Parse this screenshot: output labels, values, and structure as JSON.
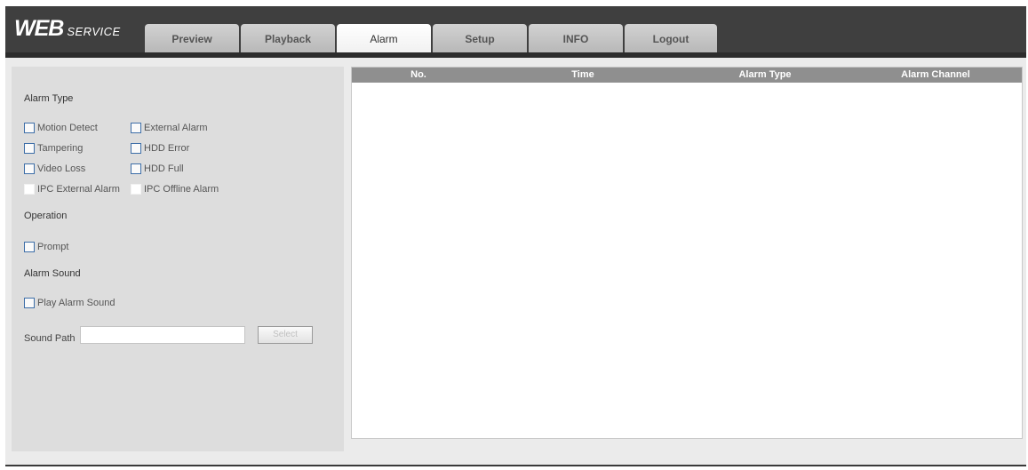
{
  "app": {
    "logo_main": "WEB",
    "logo_sub": "SERVICE"
  },
  "tabs": [
    {
      "label": "Preview",
      "active": false
    },
    {
      "label": "Playback",
      "active": false
    },
    {
      "label": "Alarm",
      "active": true
    },
    {
      "label": "Setup",
      "active": false
    },
    {
      "label": "INFO",
      "active": false
    },
    {
      "label": "Logout",
      "active": false
    }
  ],
  "alarm_type": {
    "title": "Alarm Type",
    "options": [
      {
        "label": "Motion Detect",
        "checked": false,
        "enabled": true
      },
      {
        "label": "External Alarm",
        "checked": false,
        "enabled": true
      },
      {
        "label": "Tampering",
        "checked": false,
        "enabled": true
      },
      {
        "label": "HDD Error",
        "checked": false,
        "enabled": true
      },
      {
        "label": "Video Loss",
        "checked": false,
        "enabled": true
      },
      {
        "label": "HDD Full",
        "checked": false,
        "enabled": true
      },
      {
        "label": "IPC External Alarm",
        "checked": false,
        "enabled": false
      },
      {
        "label": "IPC Offline Alarm",
        "checked": false,
        "enabled": false
      }
    ]
  },
  "operation": {
    "title": "Operation",
    "prompt_label": "Prompt",
    "prompt_checked": false
  },
  "alarm_sound": {
    "title": "Alarm Sound",
    "play_label": "Play Alarm Sound",
    "play_checked": false,
    "sound_path_label": "Sound Path",
    "sound_path_value": "",
    "select_label": "Select"
  },
  "alarm_table": {
    "columns": [
      "No.",
      "Time",
      "Alarm Type",
      "Alarm Channel"
    ],
    "rows": []
  },
  "colors": {
    "topbar": "#3f3f3f",
    "table_header": "#8f8f8f",
    "checkbox_border": "#3d6ea8"
  }
}
